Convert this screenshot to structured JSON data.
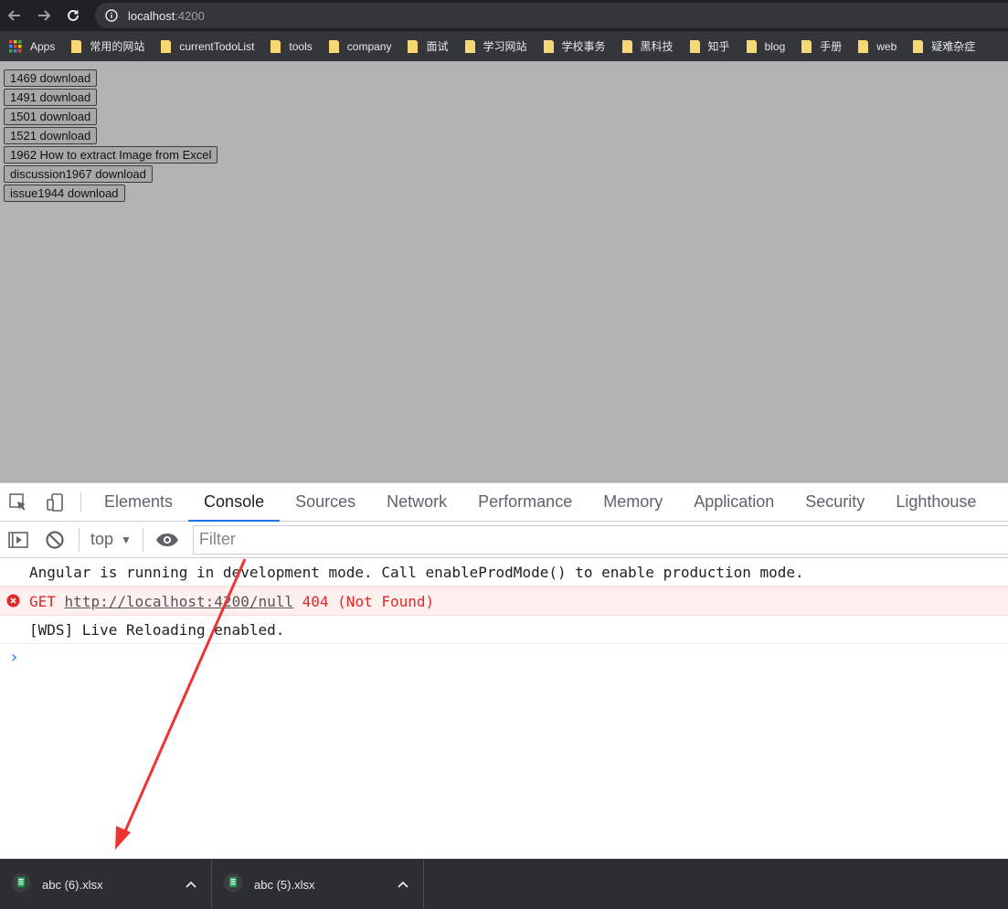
{
  "browser": {
    "url_host": "localhost",
    "url_port": ":4200",
    "bookmarks": [
      {
        "label": "Apps",
        "type": "apps"
      },
      {
        "label": "常用的网站",
        "type": "folder"
      },
      {
        "label": "currentTodoList",
        "type": "folder"
      },
      {
        "label": "tools",
        "type": "folder"
      },
      {
        "label": "company",
        "type": "folder"
      },
      {
        "label": "面试",
        "type": "folder"
      },
      {
        "label": "学习网站",
        "type": "folder"
      },
      {
        "label": "学校事务",
        "type": "folder"
      },
      {
        "label": "黑科技",
        "type": "folder"
      },
      {
        "label": "知乎",
        "type": "folder"
      },
      {
        "label": "blog",
        "type": "folder"
      },
      {
        "label": "手册",
        "type": "folder"
      },
      {
        "label": "web",
        "type": "folder"
      },
      {
        "label": "疑难杂症",
        "type": "folder"
      }
    ]
  },
  "page": {
    "buttons": [
      "1469 download",
      "1491 download",
      "1501 download",
      "1521 download",
      "1962 How to extract Image from Excel",
      "discussion1967 download",
      "issue1944 download"
    ]
  },
  "devtools": {
    "tabs": [
      "Elements",
      "Console",
      "Sources",
      "Network",
      "Performance",
      "Memory",
      "Application",
      "Security",
      "Lighthouse"
    ],
    "active_tab": "Console",
    "context": "top",
    "filter_placeholder": "Filter",
    "console_lines": {
      "angular": "Angular is running in development mode. Call enableProdMode() to enable production mode.",
      "error_method": "GET",
      "error_url": "http://localhost:4200/null",
      "error_status": "404 (Not Found)",
      "wds": "[WDS] Live Reloading enabled."
    },
    "prompt": "›"
  },
  "downloads": [
    {
      "filename": "abc (6).xlsx"
    },
    {
      "filename": "abc (5).xlsx"
    }
  ],
  "colors": {
    "accent": "#1a73e8",
    "error": "#e02828",
    "annotation_arrow": "#ee3333"
  }
}
